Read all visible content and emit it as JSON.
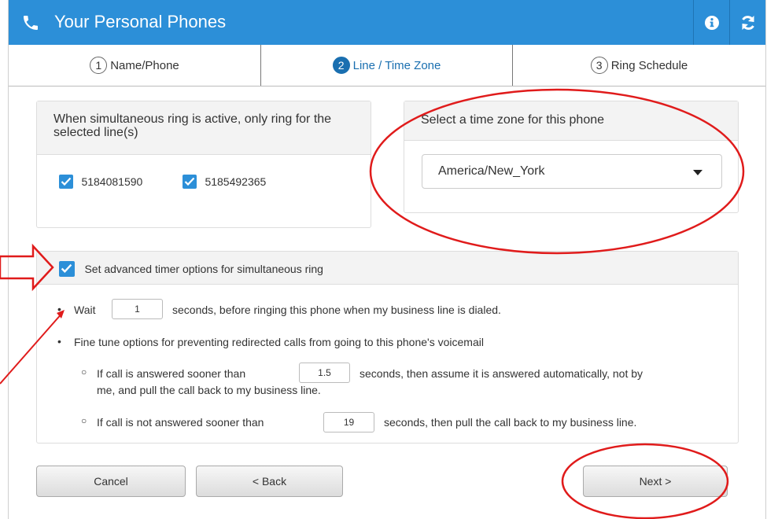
{
  "header": {
    "title": "Your Personal Phones",
    "icons": [
      "phone-icon",
      "info-icon",
      "refresh-icon"
    ]
  },
  "steps": [
    {
      "num": "1",
      "label": "Name/Phone"
    },
    {
      "num": "2",
      "label": "Line / Time Zone"
    },
    {
      "num": "3",
      "label": "Ring Schedule"
    }
  ],
  "lines_panel": {
    "title": "When simultaneous ring is active, only ring for the selected line(s)",
    "lines": [
      "5184081590",
      "5185492365"
    ]
  },
  "timezone_panel": {
    "title": "Select a time zone for this phone",
    "selected": "America/New_York"
  },
  "advanced": {
    "checkbox_label": "Set advanced timer options for simultaneous ring",
    "wait_prefix": "Wait",
    "wait_value": "1",
    "wait_suffix": "seconds, before ringing this phone when my business line is dialed.",
    "fine_tune": "Fine tune options for preventing redirected calls from going to this phone's voicemail",
    "answered_prefix": "If call is answered sooner than",
    "answered_value": "1.5",
    "answered_suffix_1": "seconds, then assume it is answered automatically, not by",
    "answered_suffix_2": "me, and pull the call back to my business line.",
    "not_answered_prefix": "If call is not answered sooner than",
    "not_answered_value": "19",
    "not_answered_suffix": "seconds, then pull the call back to my business line."
  },
  "buttons": {
    "cancel": "Cancel",
    "back": "< Back",
    "next": "Next >"
  },
  "colors": {
    "header": "#2c8fd8",
    "active_step": "#1a6fb0",
    "annotation": "#e01b1b"
  }
}
